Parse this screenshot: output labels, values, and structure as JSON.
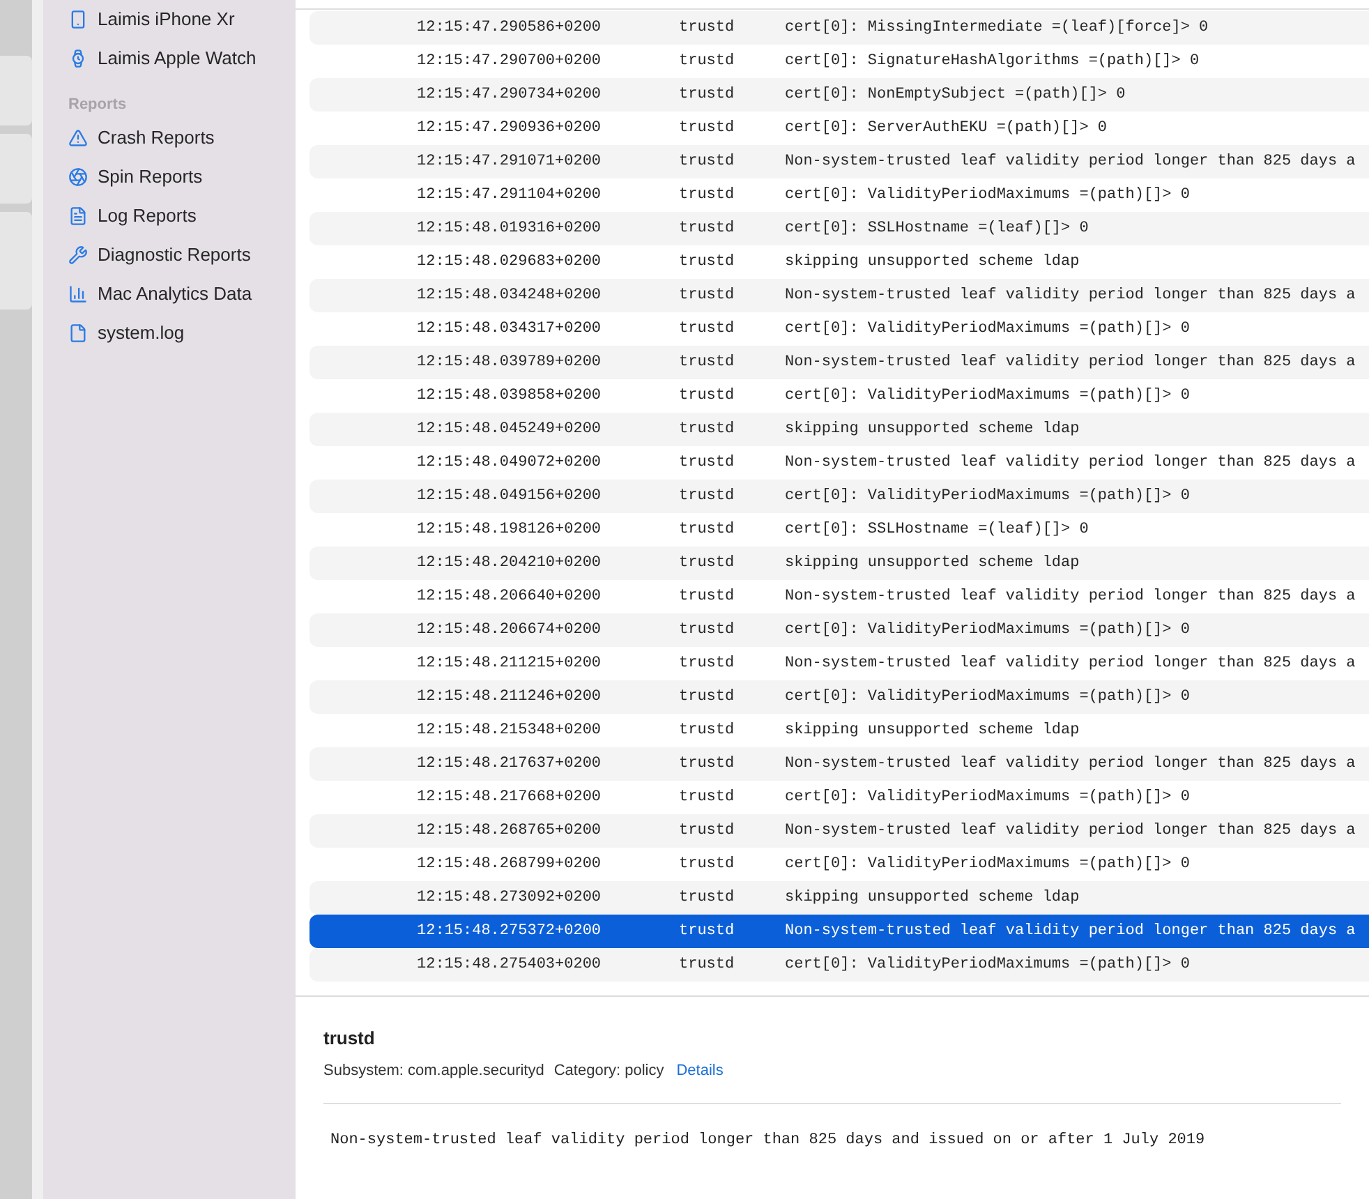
{
  "sidebar": {
    "devices": [
      {
        "label": "Laimis iPhone Xr",
        "kind": "phone"
      },
      {
        "label": "Laimis Apple Watch",
        "kind": "watch"
      }
    ],
    "section": "Reports",
    "reports": [
      {
        "label": "Crash Reports",
        "kind": "warning"
      },
      {
        "label": "Spin Reports",
        "kind": "spin"
      },
      {
        "label": "Log Reports",
        "kind": "log"
      },
      {
        "label": "Diagnostic Reports",
        "kind": "tools"
      },
      {
        "label": "Mac Analytics Data",
        "kind": "chart"
      },
      {
        "label": "system.log",
        "kind": "file"
      }
    ]
  },
  "log": {
    "rows": [
      {
        "time": "12:15:47.290586+0200",
        "process": "trustd",
        "message": "cert[0]: MissingIntermediate =(leaf)[force]> 0",
        "selected": false
      },
      {
        "time": "12:15:47.290700+0200",
        "process": "trustd",
        "message": "cert[0]: SignatureHashAlgorithms =(path)[]> 0",
        "selected": false
      },
      {
        "time": "12:15:47.290734+0200",
        "process": "trustd",
        "message": "cert[0]: NonEmptySubject =(path)[]> 0",
        "selected": false
      },
      {
        "time": "12:15:47.290936+0200",
        "process": "trustd",
        "message": "cert[0]: ServerAuthEKU =(path)[]> 0",
        "selected": false
      },
      {
        "time": "12:15:47.291071+0200",
        "process": "trustd",
        "message": "Non-system-trusted leaf validity period longer than 825 days a",
        "selected": false
      },
      {
        "time": "12:15:47.291104+0200",
        "process": "trustd",
        "message": "cert[0]: ValidityPeriodMaximums =(path)[]> 0",
        "selected": false
      },
      {
        "time": "12:15:48.019316+0200",
        "process": "trustd",
        "message": "cert[0]: SSLHostname =(leaf)[]> 0",
        "selected": false
      },
      {
        "time": "12:15:48.029683+0200",
        "process": "trustd",
        "message": "skipping unsupported scheme ldap",
        "selected": false
      },
      {
        "time": "12:15:48.034248+0200",
        "process": "trustd",
        "message": "Non-system-trusted leaf validity period longer than 825 days a",
        "selected": false
      },
      {
        "time": "12:15:48.034317+0200",
        "process": "trustd",
        "message": "cert[0]: ValidityPeriodMaximums =(path)[]> 0",
        "selected": false
      },
      {
        "time": "12:15:48.039789+0200",
        "process": "trustd",
        "message": "Non-system-trusted leaf validity period longer than 825 days a",
        "selected": false
      },
      {
        "time": "12:15:48.039858+0200",
        "process": "trustd",
        "message": "cert[0]: ValidityPeriodMaximums =(path)[]> 0",
        "selected": false
      },
      {
        "time": "12:15:48.045249+0200",
        "process": "trustd",
        "message": "skipping unsupported scheme ldap",
        "selected": false
      },
      {
        "time": "12:15:48.049072+0200",
        "process": "trustd",
        "message": "Non-system-trusted leaf validity period longer than 825 days a",
        "selected": false
      },
      {
        "time": "12:15:48.049156+0200",
        "process": "trustd",
        "message": "cert[0]: ValidityPeriodMaximums =(path)[]> 0",
        "selected": false
      },
      {
        "time": "12:15:48.198126+0200",
        "process": "trustd",
        "message": "cert[0]: SSLHostname =(leaf)[]> 0",
        "selected": false
      },
      {
        "time": "12:15:48.204210+0200",
        "process": "trustd",
        "message": "skipping unsupported scheme ldap",
        "selected": false
      },
      {
        "time": "12:15:48.206640+0200",
        "process": "trustd",
        "message": "Non-system-trusted leaf validity period longer than 825 days a",
        "selected": false
      },
      {
        "time": "12:15:48.206674+0200",
        "process": "trustd",
        "message": "cert[0]: ValidityPeriodMaximums =(path)[]> 0",
        "selected": false
      },
      {
        "time": "12:15:48.211215+0200",
        "process": "trustd",
        "message": "Non-system-trusted leaf validity period longer than 825 days a",
        "selected": false
      },
      {
        "time": "12:15:48.211246+0200",
        "process": "trustd",
        "message": "cert[0]: ValidityPeriodMaximums =(path)[]> 0",
        "selected": false
      },
      {
        "time": "12:15:48.215348+0200",
        "process": "trustd",
        "message": "skipping unsupported scheme ldap",
        "selected": false
      },
      {
        "time": "12:15:48.217637+0200",
        "process": "trustd",
        "message": "Non-system-trusted leaf validity period longer than 825 days a",
        "selected": false
      },
      {
        "time": "12:15:48.217668+0200",
        "process": "trustd",
        "message": "cert[0]: ValidityPeriodMaximums =(path)[]> 0",
        "selected": false
      },
      {
        "time": "12:15:48.268765+0200",
        "process": "trustd",
        "message": "Non-system-trusted leaf validity period longer than 825 days a",
        "selected": false
      },
      {
        "time": "12:15:48.268799+0200",
        "process": "trustd",
        "message": "cert[0]: ValidityPeriodMaximums =(path)[]> 0",
        "selected": false
      },
      {
        "time": "12:15:48.273092+0200",
        "process": "trustd",
        "message": "skipping unsupported scheme ldap",
        "selected": false
      },
      {
        "time": "12:15:48.275372+0200",
        "process": "trustd",
        "message": "Non-system-trusted leaf validity period longer than 825 days a",
        "selected": true
      },
      {
        "time": "12:15:48.275403+0200",
        "process": "trustd",
        "message": "cert[0]: ValidityPeriodMaximums =(path)[]> 0",
        "selected": false
      }
    ]
  },
  "detail": {
    "title": "trustd",
    "subsystem": "Subsystem: com.apple.securityd",
    "category": "Category: policy",
    "details_link": "Details",
    "message": "Non-system-trusted leaf validity period longer than 825 days and issued on or after 1 July 2019"
  }
}
